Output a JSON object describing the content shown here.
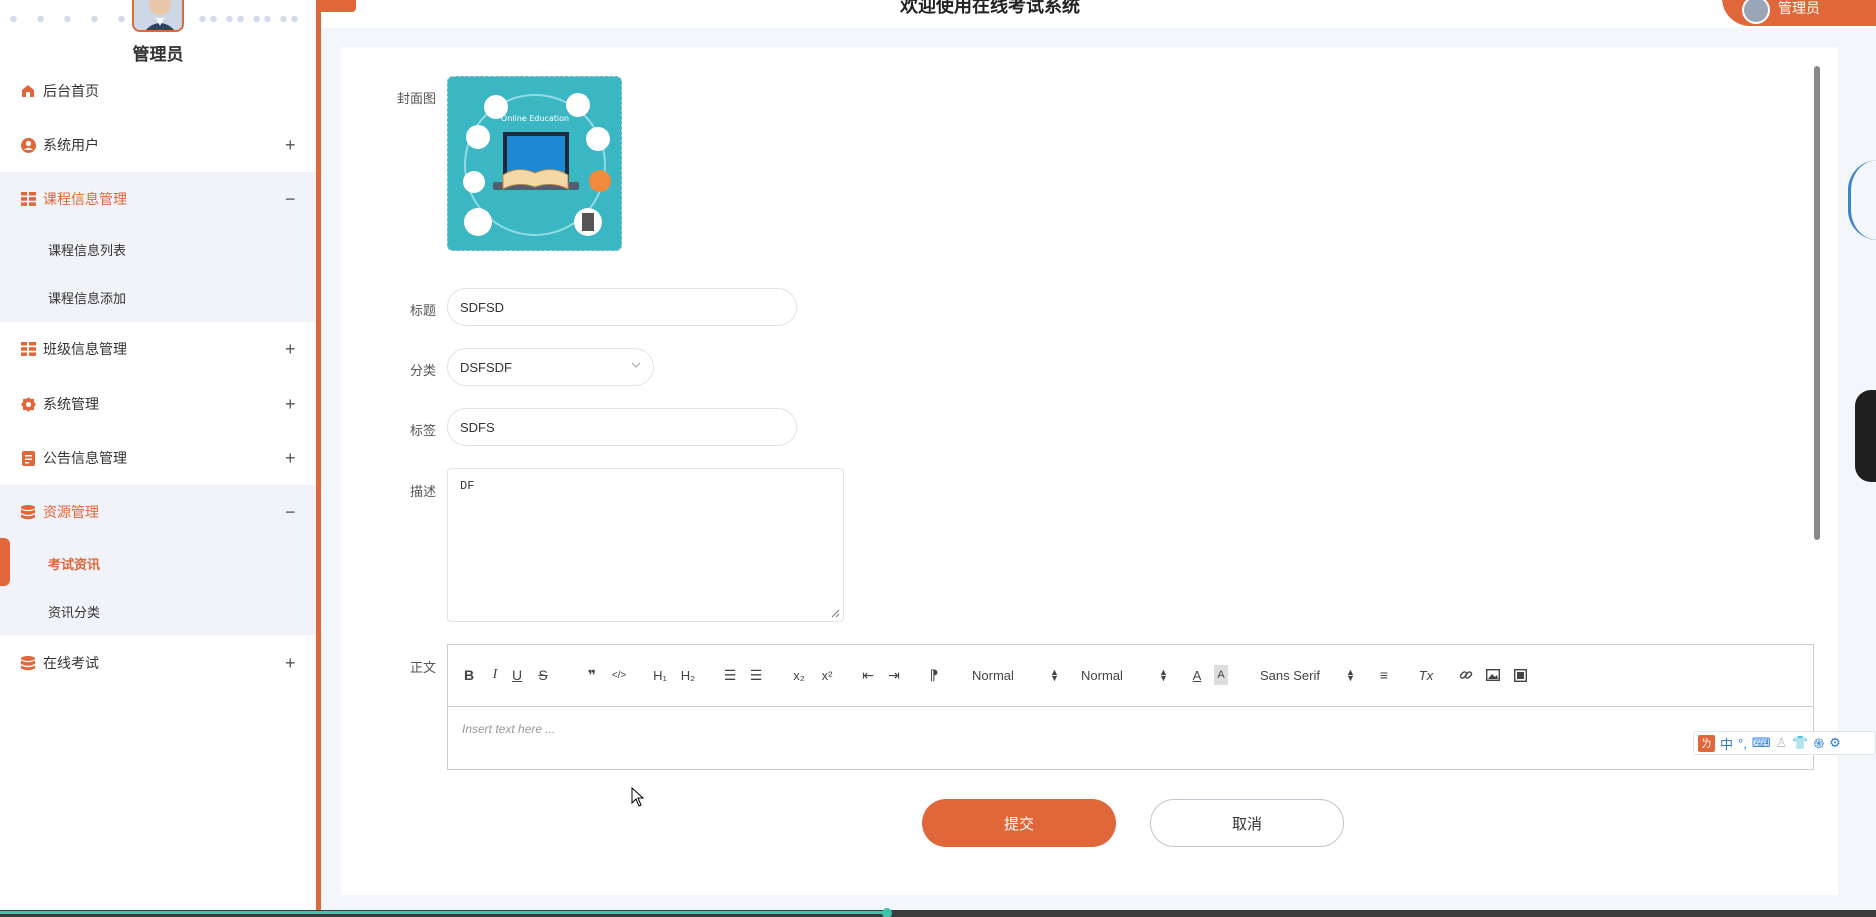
{
  "header": {
    "title": "欢迎使用在线考试系统",
    "user_label": "管理员"
  },
  "sidebar": {
    "admin_name": "管理员",
    "items": [
      {
        "label": "后台首页",
        "icon": "home-icon"
      },
      {
        "label": "系统用户",
        "icon": "user-icon",
        "toggle": "+"
      },
      {
        "label": "课程信息管理",
        "icon": "grid-icon",
        "toggle": "−",
        "children": [
          {
            "label": "课程信息列表"
          },
          {
            "label": "课程信息添加"
          }
        ]
      },
      {
        "label": "班级信息管理",
        "icon": "grid-icon",
        "toggle": "+"
      },
      {
        "label": "系统管理",
        "icon": "gear-icon",
        "toggle": "+"
      },
      {
        "label": "公告信息管理",
        "icon": "document-icon",
        "toggle": "+"
      },
      {
        "label": "资源管理",
        "icon": "database-icon",
        "toggle": "−",
        "children": [
          {
            "label": "考试资讯",
            "active": true
          },
          {
            "label": "资讯分类"
          }
        ]
      },
      {
        "label": "在线考试",
        "icon": "database-icon",
        "toggle": "+"
      }
    ]
  },
  "form": {
    "cover": {
      "label": "封面图",
      "image_text": "Online Education"
    },
    "title": {
      "label": "标题",
      "value": "SDFSD"
    },
    "category": {
      "label": "分类",
      "value": "DSFSDF"
    },
    "tags": {
      "label": "标签",
      "value": "SDFS"
    },
    "description": {
      "label": "描述",
      "value": "DF"
    },
    "content": {
      "label": "正文",
      "placeholder": "Insert text here ...",
      "toolbar": {
        "bold": "B",
        "italic": "I",
        "underline": "U",
        "strike": "S",
        "quote": "❞",
        "code": "</>",
        "h1": "H₁",
        "h2": "H₂",
        "ordered_list": "☰",
        "bullet_list": "☰",
        "subscript": "x₂",
        "superscript": "x²",
        "outdent": "⇤",
        "indent": "⇥",
        "direction": "⁋",
        "size_select": "Normal",
        "header_select": "Normal",
        "font_color": "A",
        "background_color": "A",
        "font_select": "Sans Serif",
        "align": "≡",
        "clean": "Tx",
        "link": "🔗",
        "image": "▣",
        "video": "▤"
      }
    }
  },
  "buttons": {
    "submit": "提交",
    "cancel": "取消"
  },
  "ime": {
    "logo": "ㄌ",
    "mode": "中",
    "punct": "°,",
    "keyboard": "⌨",
    "person": "♙",
    "shirt": "👕",
    "ai": "֍",
    "settings": "⚙"
  },
  "colors": {
    "accent": "#e0673a",
    "main_bg": "#f3f6fa",
    "progress": "#3fc4ac"
  }
}
